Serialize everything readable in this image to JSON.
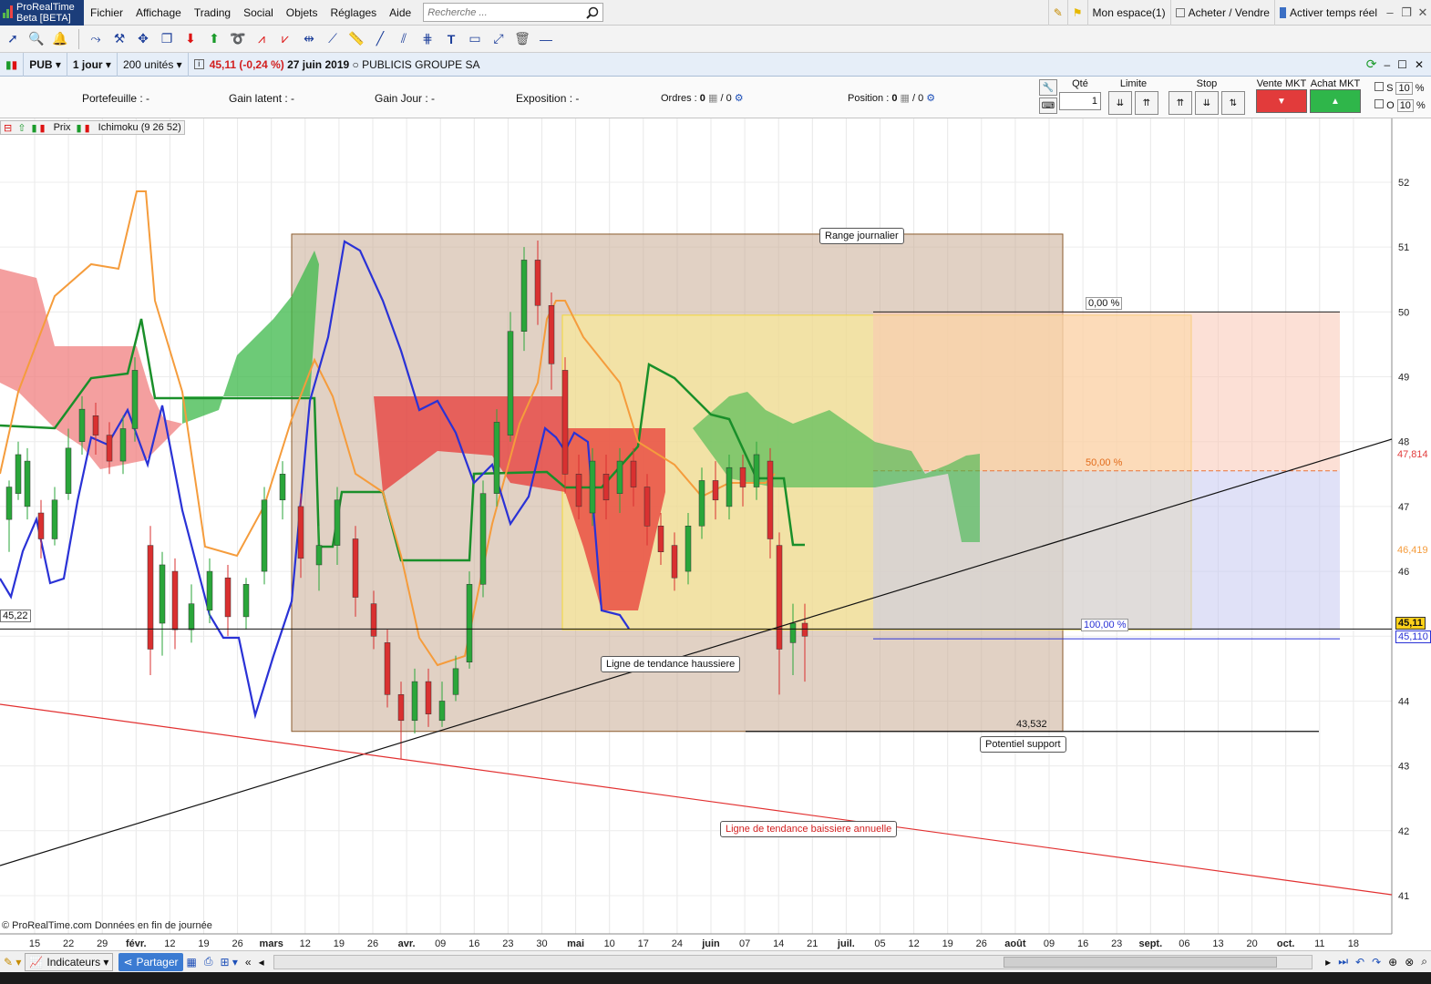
{
  "app": {
    "logo_line1": "ProRealTime",
    "logo_line2": "Beta [BETA]"
  },
  "menu": [
    "Fichier",
    "Affichage",
    "Trading",
    "Social",
    "Objets",
    "Réglages",
    "Aide"
  ],
  "search": {
    "placeholder": "Recherche ..."
  },
  "topright": {
    "space": "Mon espace(1)",
    "buy_sell": "Acheter / Vendre",
    "realtime": "Activer temps réel"
  },
  "chartbar": {
    "ticker": "PUB",
    "period": "1 jour",
    "units": "200 unités",
    "price": "45,11",
    "change": "(-0,24 %)",
    "date": "27 juin 2019",
    "name": "PUBLICIS GROUPE SA"
  },
  "orderbar": {
    "portefeuille": "Portefeuille : -",
    "gain_latent": "Gain latent : -",
    "gain_jour": "Gain Jour : -",
    "exposition": "Exposition : -",
    "ordres_label": "Ordres :",
    "ordres_a": "0",
    "ordres_b": "/ 0",
    "position_label": "Position :",
    "position_a": "0",
    "position_b": "/ 0",
    "qte_label": "Qté",
    "qte_value": "1",
    "limite_label": "Limite",
    "stop_label": "Stop",
    "vente_label": "Vente MKT",
    "achat_label": "Achat MKT",
    "s_label": "S",
    "o_label": "O",
    "s_pct": "10",
    "o_pct": "10",
    "pct": "%"
  },
  "legend": {
    "price": "Prix",
    "indicator": "Ichimoku (9 26 52)"
  },
  "annotations": {
    "range": "Range journalier",
    "uptrend": "Ligne de tendance haussiere",
    "support": "Potentiel support",
    "downtrend": "Ligne de tendance baissiere annuelle",
    "support_value": "43,532",
    "fib0": "0,00 %",
    "fib50": "50,00 %",
    "fib100": "100,00 %",
    "hline_left": "45,22"
  },
  "price_tags": {
    "current": "45,11",
    "lower": "45,110",
    "orange": "46,419",
    "orange2": "47,814"
  },
  "watermark": "© ProRealTime.com  Données en fin de journée",
  "chart_data": {
    "type": "candlestick",
    "yticks": [
      "52",
      "51",
      "50",
      "49",
      "48",
      "47",
      "46",
      "45",
      "44",
      "43",
      "42",
      "41"
    ],
    "xticks": [
      "15",
      "22",
      "29",
      "févr.",
      "12",
      "19",
      "26",
      "mars",
      "12",
      "19",
      "26",
      "avr.",
      "09",
      "16",
      "23",
      "30",
      "mai",
      "10",
      "17",
      "24",
      "juin",
      "07",
      "14",
      "21",
      "juil.",
      "05",
      "12",
      "19",
      "26",
      "août",
      "09",
      "16",
      "23",
      "sept.",
      "06",
      "13",
      "20",
      "oct.",
      "11",
      "18"
    ],
    "ylim": [
      40.5,
      52.8
    ],
    "levels": {
      "range_top": 51.2,
      "range_bottom": 43.532,
      "fib0": 50.0,
      "fib50": 47.55,
      "fib100": 45.1,
      "current": 45.11
    },
    "colors": {
      "kumo_bull": "#3cb84a",
      "kumo_bear": "#e8312f",
      "tenkan": "#f59c3c",
      "kijun": "#1a8f2a",
      "chikou": "#2a32d6",
      "range_box": "#c9ab93",
      "fib_yellow": "#fdec93",
      "fib_red": "#f9c7b5",
      "fib_blue": "#c7c9f0"
    }
  },
  "bottom": {
    "indicators": "Indicateurs",
    "share": "Partager"
  }
}
